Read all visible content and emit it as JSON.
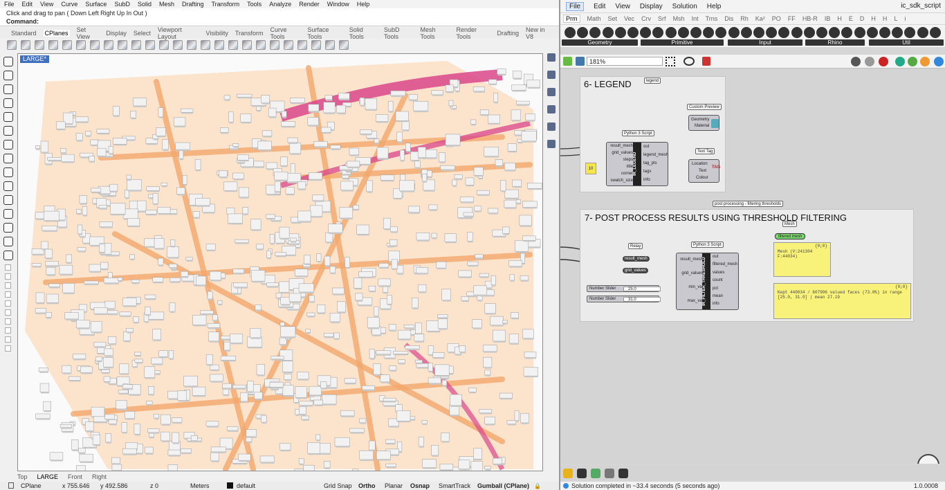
{
  "rhino": {
    "menu": [
      "File",
      "Edit",
      "View",
      "Curve",
      "Surface",
      "SubD",
      "Solid",
      "Mesh",
      "Drafting",
      "Transform",
      "Tools",
      "Analyze",
      "Render",
      "Window",
      "Help"
    ],
    "command_history": "Click and drag to pan ( Down  Left  Right  Up  In  Out )",
    "command_prompt": "Command:",
    "tabs": [
      "Standard",
      "CPlanes",
      "Set View",
      "Display",
      "Select",
      "Viewport Layout",
      "Visibility",
      "Transform",
      "Curve Tools",
      "Surface Tools",
      "Solid Tools",
      "SubD Tools",
      "Mesh Tools",
      "Render Tools",
      "Drafting",
      "New in V8"
    ],
    "active_tab": "CPlanes",
    "viewport_label": "LARGE*",
    "viewport_tabs": [
      "Top",
      "LARGE",
      "Front",
      "Right"
    ],
    "active_viewport_tab": "LARGE",
    "status": {
      "cplane": "CPlane",
      "x": "x 755.646",
      "y": "y 492.586",
      "z": "z 0",
      "units": "Meters",
      "layer": "default",
      "grid_snap": "Grid Snap",
      "ortho": "Ortho",
      "planar": "Planar",
      "osnap": "Osnap",
      "smarttrack": "SmartTrack",
      "gumball": "Gumball (CPlane)"
    },
    "colors": {
      "hot": "#d9468a",
      "warm": "#f3a86c",
      "building": "#f2f2f2",
      "ground": "#fbe3cc"
    }
  },
  "gh": {
    "menu": [
      "File",
      "Edit",
      "View",
      "Display",
      "Solution",
      "Help"
    ],
    "active_menu": "File",
    "title": "ic_sdk_script",
    "tabs": [
      "Prm",
      "Math",
      "Set",
      "Vec",
      "Crv",
      "Srf",
      "Msh",
      "Int",
      "Trns",
      "Dis",
      "Rh",
      "Ka²",
      "PO",
      "FF",
      "HB-R",
      "IB",
      "H",
      "E",
      "D",
      "H",
      "H",
      "L",
      "i"
    ],
    "active_tab": "Prm",
    "panel_groups": [
      "Geometry",
      "Primitive",
      "Input",
      "Rhino",
      "Util"
    ],
    "zoom": "181%",
    "group6": {
      "title": "6- LEGEND",
      "tag": "legend",
      "script_label": "Python 3 Script",
      "script_name": "IR_LEGEND",
      "inputs": [
        "result_mesh",
        "grid_values",
        "steps",
        "title",
        "corner",
        "swatch_size"
      ],
      "outputs": [
        "out",
        "legend_mesh",
        "tag_pts",
        "tags",
        "info"
      ],
      "number_value": "10",
      "preview_label": "Custom Preview",
      "preview_ports": [
        "Geometry",
        "Material"
      ],
      "texttag_label": "Text Tag",
      "texttag_ports": [
        "Location",
        "Text",
        "Colour"
      ]
    },
    "group7": {
      "title": "7- POST PROCESS RESULTS USING THRESHOLD FILTERING",
      "tag": "post processing - filtering thresholds",
      "mesh_label": "Mesh",
      "filtered_mesh": "filtered mesh",
      "relay_label": "Relay",
      "relay_outputs": [
        "result_mesh",
        "grid_values"
      ],
      "script_label": "Python 3 Script",
      "script_name": "IR_FILTER_THRESHOLD",
      "inputs": [
        "result_mesh",
        "grid_values",
        "min_val",
        "max_val"
      ],
      "outputs": [
        "out",
        "filtered_mesh",
        "values",
        "count",
        "pct",
        "mean",
        "info"
      ],
      "sliders": [
        {
          "label": "Number Slider",
          "value": "25.0"
        },
        {
          "label": "Number Slider",
          "value": "31.0"
        }
      ],
      "panel1_header": "{0;0}",
      "panel1_text": "Mesh (V:241304 F:44034)",
      "panel2_header": "{0;0}",
      "panel2_text": "Kept 440034 / 607996 valued faces (73.0%) in range [25.0, 31.0] | mean 27.19"
    },
    "status": "Solution completed in ~33.4 seconds (5 seconds ago)",
    "version": "1.0.0008"
  }
}
